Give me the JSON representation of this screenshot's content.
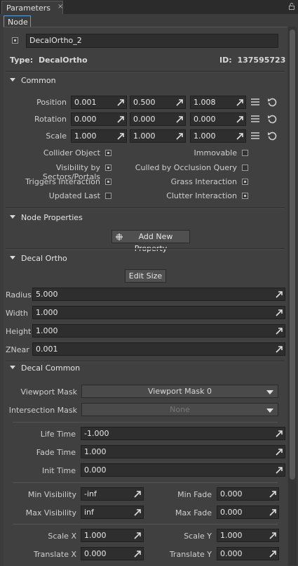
{
  "tabs": {
    "parameters": "Parameters",
    "close": "×",
    "node": "Node"
  },
  "node": {
    "name": "DecalOrtho_2",
    "type_label": "Type:",
    "type_value": "DecalOrtho",
    "id_label": "ID:",
    "id_value": "137595723"
  },
  "common": {
    "title": "Common",
    "rows": [
      {
        "label": "Position",
        "x": "0.001",
        "y": "0.500",
        "z": "1.008"
      },
      {
        "label": "Rotation",
        "x": "0.000",
        "y": "0.000",
        "z": "0.000"
      },
      {
        "label": "Scale",
        "x": "1.000",
        "y": "1.000",
        "z": "1.000"
      }
    ],
    "flags": [
      {
        "label": "Collider Object",
        "checked": true
      },
      {
        "label": "Immovable",
        "checked": false
      },
      {
        "label": "Visibility by Sectors/Portals",
        "checked": true
      },
      {
        "label": "Culled by Occlusion Query",
        "checked": false
      },
      {
        "label": "Triggers Interaction",
        "checked": true
      },
      {
        "label": "Grass Interaction",
        "checked": true
      },
      {
        "label": "Updated Last",
        "checked": false
      },
      {
        "label": "Clutter Interaction",
        "checked": true
      }
    ]
  },
  "node_properties": {
    "title": "Node Properties",
    "add_button": "Add New Property"
  },
  "decal_ortho": {
    "title": "Decal Ortho",
    "edit_button": "Edit Size",
    "fields": [
      {
        "label": "Radius",
        "value": "5.000"
      },
      {
        "label": "Width",
        "value": "1.000"
      },
      {
        "label": "Height",
        "value": "1.000"
      },
      {
        "label": "ZNear",
        "value": "0.001"
      }
    ]
  },
  "decal_common": {
    "title": "Decal Common",
    "viewport_mask_label": "Viewport Mask",
    "viewport_mask_value": "Viewport Mask 0",
    "intersection_mask_label": "Intersection Mask",
    "intersection_mask_value": "None",
    "life_time_label": "Life Time",
    "life_time": "-1.000",
    "fade_time_label": "Fade Time",
    "fade_time": "1.000",
    "init_time_label": "Init Time",
    "init_time": "0.000",
    "min_visibility_label": "Min Visibility",
    "min_visibility": "-inf",
    "min_fade_label": "Min Fade",
    "min_fade": "0.000",
    "max_visibility_label": "Max Visibility",
    "max_visibility": "inf",
    "max_fade_label": "Max Fade",
    "max_fade": "0.000",
    "scale_x_label": "Scale X",
    "scale_x": "1.000",
    "scale_y_label": "Scale Y",
    "scale_y": "1.000",
    "translate_x_label": "Translate X",
    "translate_x": "0.000",
    "translate_y_label": "Translate Y",
    "translate_y": "0.000"
  }
}
